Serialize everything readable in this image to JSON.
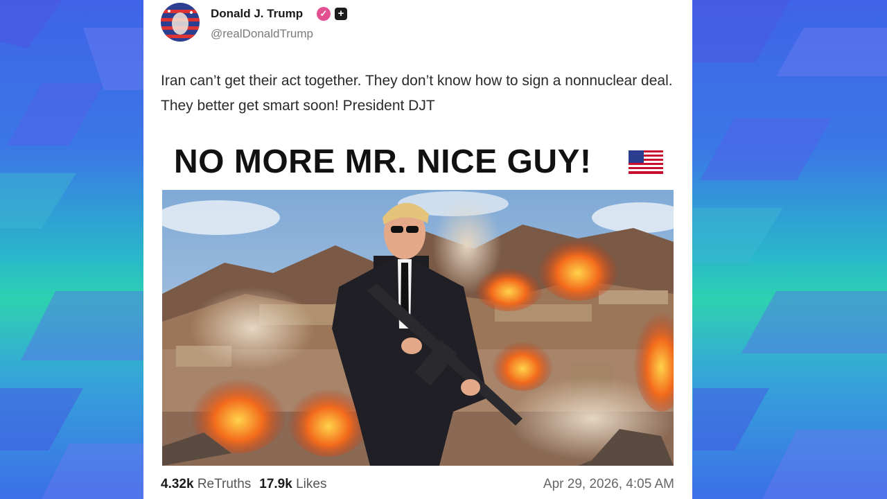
{
  "post": {
    "author_name": "Donald J. Trump",
    "handle": "@realDonaldTrump",
    "verified_icon": "checkmark-badge-icon",
    "plus_icon": "plus-badge-icon",
    "text": "Iran can’t get their act together. They don’t know how to sign a nonnuclear deal. They better get smart soon! President DJT",
    "image_headline": "NO MORE MR. NICE GUY!",
    "image_flag_icon": "us-flag-icon",
    "retruths_count": "4.32k",
    "retruths_label": "ReTruths",
    "likes_count": "17.9k",
    "likes_label": "Likes",
    "timestamp": "Apr 29, 2026, 4:05 AM"
  },
  "colors": {
    "verified_badge": "#e3508f",
    "background_top": "#3f63e8",
    "background_mid": "#2ed1b0"
  }
}
